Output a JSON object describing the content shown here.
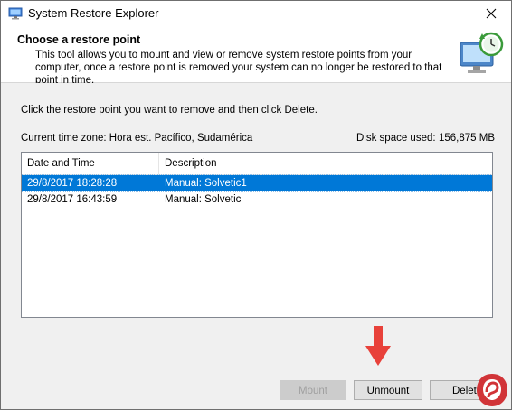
{
  "window": {
    "title": "System Restore Explorer",
    "close_glyph": "✕"
  },
  "header": {
    "title": "Choose a restore point",
    "description": "This tool allows you to mount and view or remove system restore points from your computer, once a restore point is removed your system can no longer be restored to that point in time.",
    "icon": "monitor-restore-icon"
  },
  "content": {
    "instruction": "Click the restore point you want to remove and then click Delete.",
    "timezone_label": "Current time zone: Hora est. Pacífico, Sudamérica",
    "disk_space_label": "Disk space used:",
    "disk_space_value": "156,875 MB"
  },
  "list": {
    "columns": [
      "Date and Time",
      "Description"
    ],
    "rows": [
      {
        "date": "29/8/2017 18:28:28",
        "description": "Manual: Solvetic1",
        "selected": true
      },
      {
        "date": "29/8/2017 16:43:59",
        "description": "Manual: Solvetic",
        "selected": false
      }
    ]
  },
  "buttons": {
    "mount": "Mount",
    "unmount": "Unmount",
    "delete": "Delete"
  },
  "colors": {
    "selection": "#0078d7",
    "annotation_arrow": "#e8413a",
    "logo": "#d13438"
  }
}
